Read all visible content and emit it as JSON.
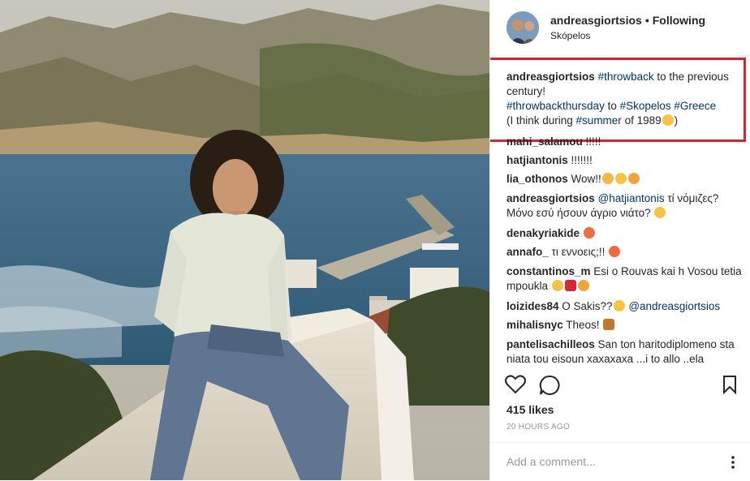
{
  "post": {
    "username": "andreasgiortsios",
    "separator": "•",
    "follow_status": "Following",
    "location": "Skópelos"
  },
  "caption": {
    "user": "andreasgiortsios",
    "tag1": "#throwback",
    "text1": " to the previous century!",
    "tag2": "#throwbackthursday",
    "text2": " to ",
    "tag3": "#Skopelos",
    "tag4": "#Greece",
    "text3": "(I think during ",
    "tag5": "#summer",
    "text4": " of 1989",
    "text5": ")"
  },
  "comments": [
    {
      "user": "mahi_salamou",
      "text": " !!!!!"
    },
    {
      "user": "hatjiantonis",
      "text": " !!!!!!!"
    },
    {
      "user": "lia_othonos",
      "text": " Wow!!"
    },
    {
      "user": "andreasgiortsios",
      "mention": "@hatjiantonis",
      "text": " τί νόμιζες? Μόνο εσύ ήσουν άγριο νιάτο?"
    },
    {
      "user": "denakyriakide",
      "text": " "
    },
    {
      "user": "annafo_",
      "text": " τι εννοεις;!!"
    },
    {
      "user": "constantinos_m",
      "text": " Esi o Rouvas kai h Vosou tetia mpoukla"
    },
    {
      "user": "loizides84",
      "text": " O Sakis??",
      "mention": "@andreasgiortsios"
    },
    {
      "user": "mihalisnyc",
      "text": " Theos!"
    },
    {
      "user": "pantelisachilleos",
      "text": " San ton haritodiplomeno sta niata tou eisoun xaxaxaxa ...i to allo ..ela"
    }
  ],
  "likes": "415 likes",
  "time": "20 HOURS AGO",
  "add_comment_placeholder": "Add a comment...",
  "colors": {
    "highlight": "#e0202a",
    "link": "#003569"
  },
  "icons": [
    "heart-icon",
    "comment-icon",
    "bookmark-icon",
    "more-options-icon"
  ]
}
